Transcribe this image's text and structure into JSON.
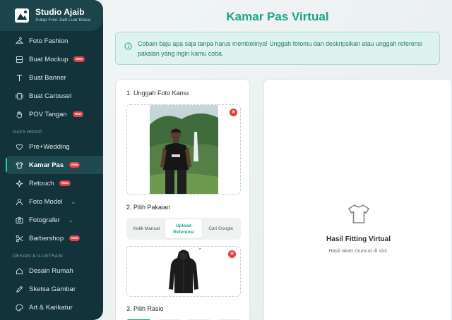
{
  "brand": {
    "title": "Studio Ajaib",
    "subtitle": "Sulap Foto Jadi Luar Biasa"
  },
  "sidebar": {
    "items": [
      {
        "label": "Foto Fashion",
        "icon": "hanger-icon"
      },
      {
        "label": "Buat Mockup",
        "icon": "mockup-icon",
        "badge": "New"
      },
      {
        "label": "Buat Banner",
        "icon": "text-icon"
      },
      {
        "label": "Buat Carousel",
        "icon": "carousel-icon"
      },
      {
        "label": "POV Tangan",
        "icon": "hand-icon",
        "badge": "New"
      }
    ],
    "section_gaya": "GAYA HIDUP",
    "gaya_items": [
      {
        "label": "Pre+Wedding",
        "icon": "heart-icon"
      },
      {
        "label": "Kamar Pas",
        "icon": "tshirt-icon",
        "badge": "New",
        "active": true
      },
      {
        "label": "Retouch",
        "icon": "sparkle-icon",
        "badge": "New"
      },
      {
        "label": "Foto Model",
        "icon": "user-icon",
        "chevron": true
      },
      {
        "label": "Fotografer",
        "icon": "camera-icon",
        "chevron": true
      },
      {
        "label": "Barbershop",
        "icon": "scissors-icon",
        "badge": "New"
      }
    ],
    "section_desain": "DESAIN & ILUSTRASI",
    "desain_items": [
      {
        "label": "Desain Rumah",
        "icon": "home-icon"
      },
      {
        "label": "Sketsa Gambar",
        "icon": "pencil-icon"
      },
      {
        "label": "Art & Karikatur",
        "icon": "palette-icon"
      }
    ]
  },
  "main": {
    "title": "Kamar Pas Virtual",
    "info": "Cobain baju apa saja tanpa harus membelinya! Unggah fotomu dan deskripsikan atau unggah referensi pakaian yang ingin kamu coba.",
    "step1": "1. Unggah Foto Kamu",
    "step2": "2. Pilih Pakaian",
    "step3": "3. Pilih Rasio",
    "tabs": [
      "Ketik Manual",
      "Upload Referensi",
      "Cari Google"
    ],
    "result_title": "Hasil Fitting Virtual",
    "result_sub": "Hasil akan muncul di sini."
  },
  "colors": {
    "accent": "#1aa58b",
    "sidebar": "#12333a",
    "badge": "#e0434b"
  }
}
